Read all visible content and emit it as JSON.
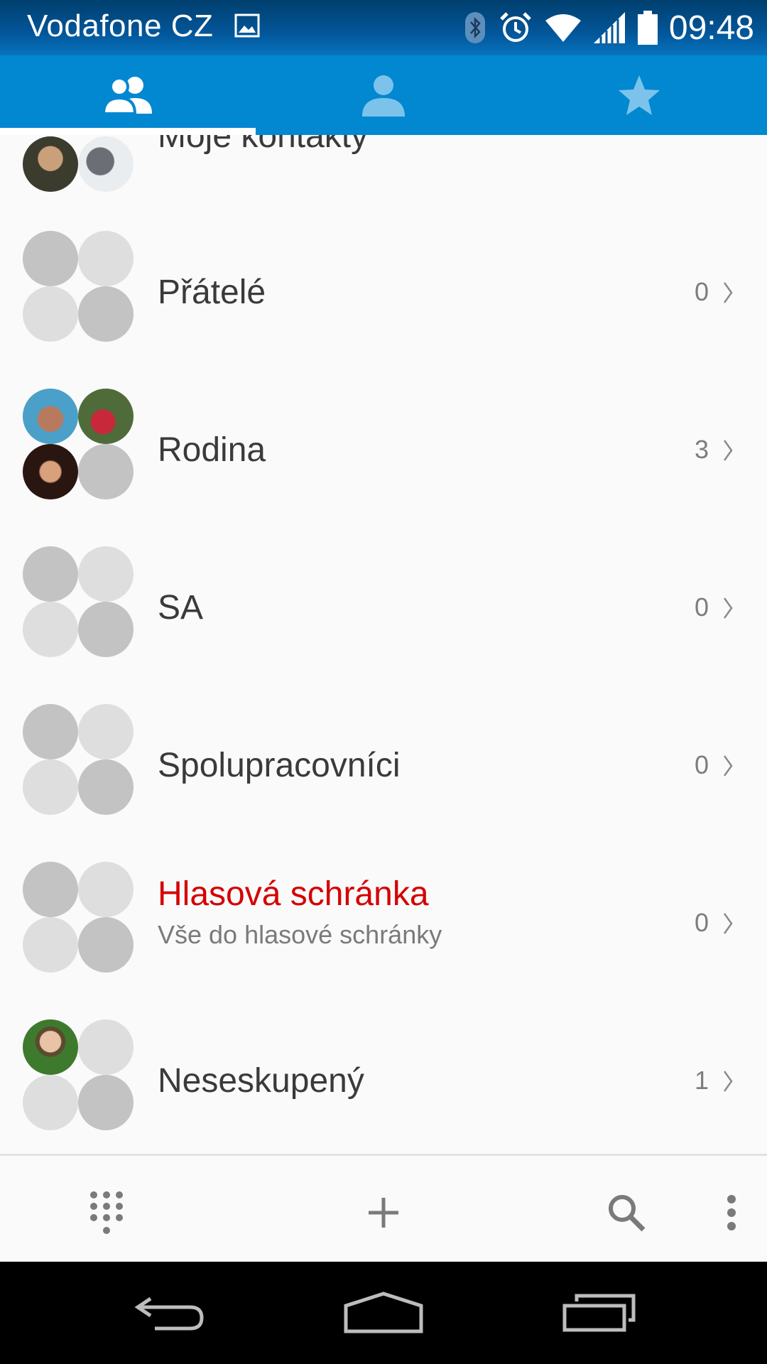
{
  "status_bar": {
    "carrier": "Vodafone CZ",
    "time": "09:48",
    "icons": [
      "gallery-icon",
      "bluetooth-icon",
      "alarm-icon",
      "wifi-icon",
      "signal-icon",
      "battery-icon"
    ]
  },
  "tabs": [
    {
      "name": "groups",
      "icon": "groups-icon",
      "selected": true
    },
    {
      "name": "contacts",
      "icon": "person-icon",
      "selected": false
    },
    {
      "name": "favorites",
      "icon": "star-icon",
      "selected": false
    }
  ],
  "groups": [
    {
      "name": "Moje kontakty",
      "count": "",
      "subtitle": ""
    },
    {
      "name": "Přátelé",
      "count": "0",
      "subtitle": ""
    },
    {
      "name": "Rodina",
      "count": "3",
      "subtitle": ""
    },
    {
      "name": "SA",
      "count": "0",
      "subtitle": ""
    },
    {
      "name": "Spolupracovníci",
      "count": "0",
      "subtitle": ""
    },
    {
      "name": "Hlasová schránka",
      "count": "0",
      "subtitle": "Vše do hlasové schránky"
    },
    {
      "name": "Neseskupený",
      "count": "1",
      "subtitle": ""
    }
  ],
  "action_bar": {
    "icons": [
      "dialpad-icon",
      "add-icon",
      "search-icon",
      "overflow-menu-icon"
    ]
  },
  "nav_bar": {
    "icons": [
      "back-icon",
      "home-icon",
      "recents-icon"
    ]
  },
  "colors": {
    "status_bar": "#02569a",
    "tab_bar": "#0288d1",
    "highlight_text": "#d50000",
    "background": "#fafafa"
  }
}
